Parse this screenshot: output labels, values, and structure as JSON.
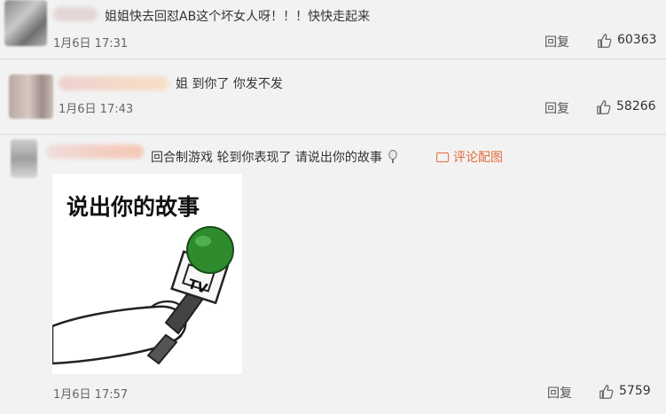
{
  "comments": [
    {
      "text": "姐姐快去回怼AB这个坏女人呀！！！快快走起来",
      "time": "1月6日 17:31",
      "reply_label": "回复",
      "likes": "60363"
    },
    {
      "text": "姐 到你了 你发不发",
      "time": "1月6日 17:43",
      "reply_label": "回复",
      "likes": "58266"
    },
    {
      "text": "回合制游戏 轮到你表现了 请说出你的故事",
      "pic_link": "评论配图",
      "image_caption": "说出你的故事",
      "image_badge": "TV",
      "time": "1月6日 17:57",
      "reply_label": "回复",
      "likes": "5759"
    }
  ],
  "icons": {
    "like": "thumbs-up-icon",
    "microphone_emoji": "microphone-emoji-icon",
    "picture": "picture-icon"
  },
  "colors": {
    "background": "#f2f2f2",
    "link": "#e86a3c",
    "mic_head": "#2e8b2e"
  }
}
